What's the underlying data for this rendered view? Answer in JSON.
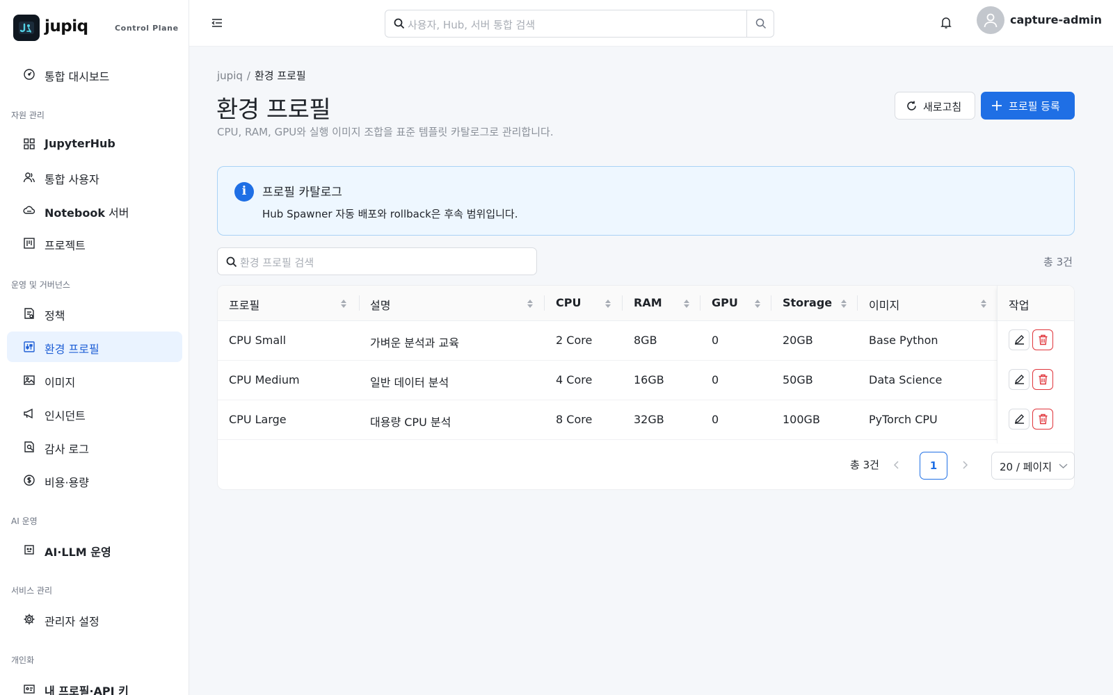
{
  "brand": {
    "name": "jupiq",
    "subtitle": "Control Plane"
  },
  "sidebar": {
    "dashboard": "통합 대시보드",
    "sections": {
      "resources": "자원 관리",
      "ops": "운영 및 거버넌스",
      "ai": "AI 운영",
      "service": "서비스 관리",
      "personal": "개인화"
    },
    "items": {
      "jupyterhub": "JupyterHub",
      "users": "통합 사용자",
      "notebook_bold": "Notebook",
      "notebook_rest": " 서버",
      "projects": "프로젝트",
      "policy": "정책",
      "env_profile": "환경 프로필",
      "images": "이미지",
      "incidents": "인시던트",
      "audit": "감사 로그",
      "cost": "비용·용량",
      "ai_llm": "AI·LLM 운영",
      "admin_settings": "관리자 설정",
      "my_profile": "내 프로필·API 키"
    }
  },
  "header": {
    "search_placeholder": "사용자, Hub, 서버 통합 검색",
    "user_name": "capture-admin"
  },
  "breadcrumb": {
    "root": "jupiq",
    "separator": "/",
    "current": "환경 프로필"
  },
  "page": {
    "title": "환경 프로필",
    "subtitle": "CPU, RAM, GPU와 실행 이미지 조합을 표준 템플릿 카탈로그로 관리합니다.",
    "refresh_label": "새로고침",
    "add_label": "프로필 등록"
  },
  "info": {
    "title": "프로필 카탈로그",
    "description": "Hub Spawner 자동 배포와 rollback은 후속 범위입니다."
  },
  "filter": {
    "placeholder": "환경 프로필 검색",
    "total": "총 3건"
  },
  "table": {
    "headers": {
      "profile": "프로필",
      "description": "설명",
      "cpu": "CPU",
      "ram": "RAM",
      "gpu": "GPU",
      "storage": "Storage",
      "image": "이미지",
      "actions": "작업"
    },
    "rows": [
      {
        "profile": "CPU Small",
        "description": "가벼운 분석과 교육",
        "cpu": "2 Core",
        "ram": "8GB",
        "gpu": "0",
        "storage": "20GB",
        "image": "Base Python"
      },
      {
        "profile": "CPU Medium",
        "description": "일반 데이터 분석",
        "cpu": "4 Core",
        "ram": "16GB",
        "gpu": "0",
        "storage": "50GB",
        "image": "Data Science"
      },
      {
        "profile": "CPU Large",
        "description": "대용량 CPU 분석",
        "cpu": "8 Core",
        "ram": "32GB",
        "gpu": "0",
        "storage": "100GB",
        "image": "PyTorch CPU"
      }
    ]
  },
  "pagination": {
    "total": "총 3건",
    "current_page": "1",
    "page_size": "20 / 페이지"
  },
  "colors": {
    "primary": "#1f6fe5",
    "danger": "#e0353b",
    "active_bg": "#eaf3ff",
    "info_bg": "#eef7ff"
  }
}
